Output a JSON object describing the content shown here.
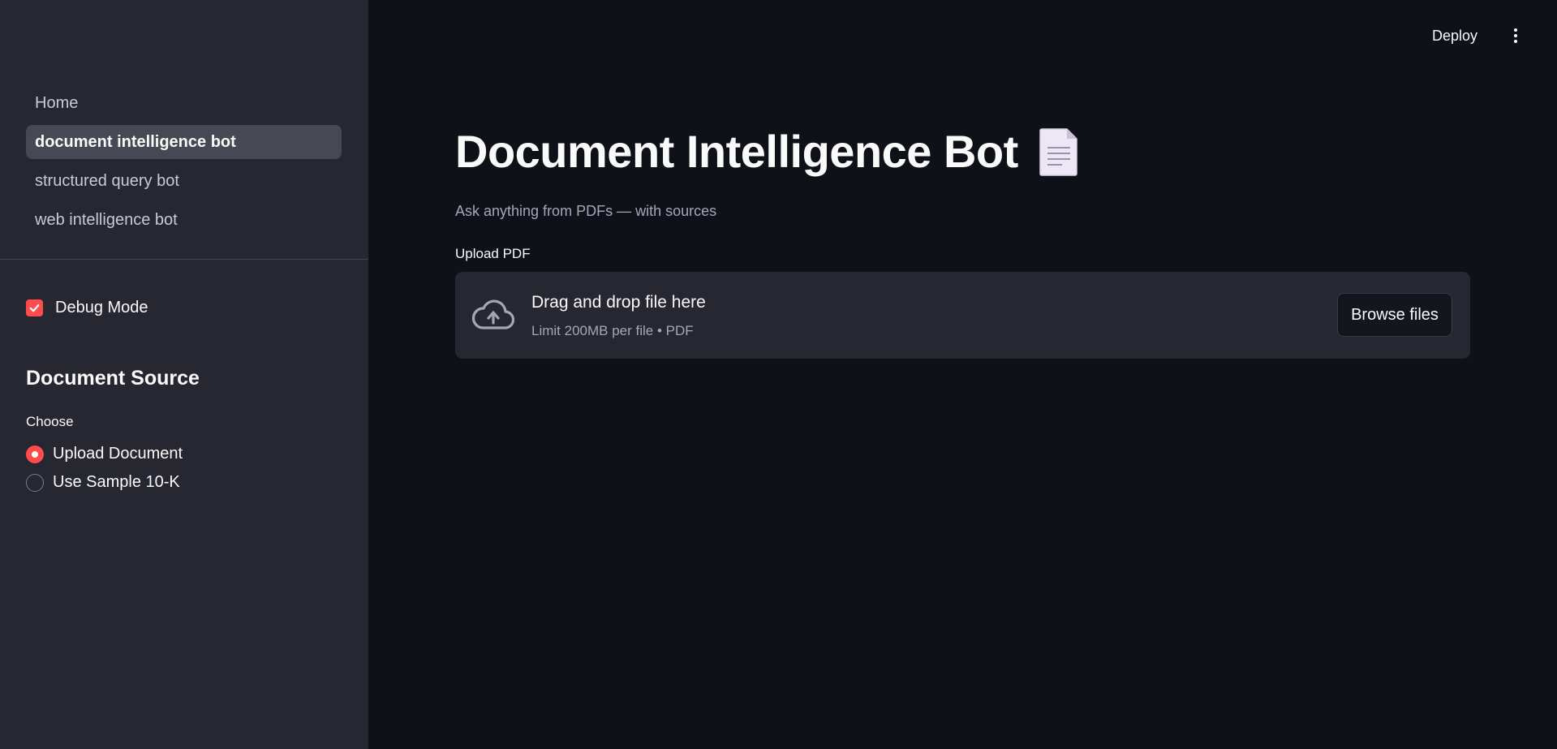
{
  "sidebar": {
    "nav": [
      {
        "label": "Home",
        "active": false
      },
      {
        "label": "document intelligence bot",
        "active": true
      },
      {
        "label": "structured query bot",
        "active": false
      },
      {
        "label": "web intelligence bot",
        "active": false
      }
    ],
    "debug": {
      "label": "Debug Mode",
      "checked": true
    },
    "section_title": "Document Source",
    "choose_label": "Choose",
    "radio_options": [
      {
        "label": "Upload Document",
        "selected": true
      },
      {
        "label": "Use Sample 10-K",
        "selected": false
      }
    ]
  },
  "header": {
    "deploy_label": "Deploy",
    "menu_icon": "kebab-menu-icon"
  },
  "main": {
    "title": "Document Intelligence Bot",
    "title_icon": "page-facing-up-icon",
    "subtitle": "Ask anything from PDFs — with sources",
    "upload_label": "Upload PDF",
    "dropzone": {
      "icon": "cloud-upload-icon",
      "main_text": "Drag and drop file here",
      "sub_text": "Limit 200MB per file • PDF",
      "browse_label": "Browse files"
    }
  },
  "colors": {
    "sidebar_bg": "#262730",
    "main_bg": "#0e1117",
    "accent": "#ff4b4b",
    "active_nav_bg": "#464853"
  }
}
